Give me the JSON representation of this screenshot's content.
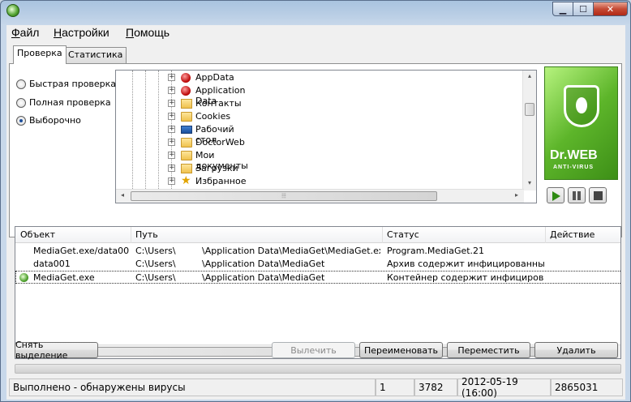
{
  "window": {
    "controls": {
      "minimize": "▁",
      "maximize": "☐",
      "close": "✕"
    }
  },
  "menu": {
    "file_ul": "Ф",
    "file_rest": "айл",
    "settings_ul": "Н",
    "settings_rest": "астройки",
    "help_ul": "П",
    "help_rest": "омощь"
  },
  "tabs": [
    {
      "label": "Проверка"
    },
    {
      "label": "Статистика"
    }
  ],
  "scan_modes": [
    {
      "label": "Быстрая проверка",
      "checked": false
    },
    {
      "label": "Полная проверка",
      "checked": false
    },
    {
      "label": "Выборочно",
      "checked": true
    }
  ],
  "tree": {
    "items": [
      {
        "label": "AppData",
        "icon": "red-dot-icon"
      },
      {
        "label": "Application Data",
        "icon": "red-dot-icon"
      },
      {
        "label": "Контакты",
        "icon": "contacts-folder-icon"
      },
      {
        "label": "Cookies",
        "icon": "folder-icon"
      },
      {
        "label": "Рабочий стол",
        "icon": "desktop-icon"
      },
      {
        "label": "DoctorWeb",
        "icon": "folder-icon"
      },
      {
        "label": "Мои документы",
        "icon": "folder-icon"
      },
      {
        "label": "Загрузки",
        "icon": "downloads-folder-icon"
      },
      {
        "label": "Избранное",
        "icon": "favorites-star-icon"
      }
    ]
  },
  "logo": {
    "title": "Dr.WEB",
    "subtitle": "ANTI-VIRUS"
  },
  "grid": {
    "columns": [
      "Объект",
      "Путь",
      "Статус",
      "Действие"
    ],
    "rows": [
      {
        "object": "MediaGet.exe/data00...",
        "path_a": "C:\\Users\\",
        "path_b": "\\Application Data\\MediaGet\\MediaGet.exe...",
        "status": "Program.MediaGet.21",
        "action": ""
      },
      {
        "object": "data001",
        "path_a": "C:\\Users\\",
        "path_b": "\\Application Data\\MediaGet",
        "status": "Архив содержит инфицированные...",
        "action": ""
      },
      {
        "object": "MediaGet.exe",
        "path_a": "C:\\Users\\",
        "path_b": "\\Application Data\\MediaGet",
        "status": "Контейнер содержит инфицирова...",
        "action": ""
      }
    ]
  },
  "buttons": {
    "deselect": "Снять выделение",
    "cure": "Вылечить",
    "rename": "Переименовать",
    "move": "Переместить",
    "delete": "Удалить"
  },
  "status": {
    "message": "Выполнено - обнаружены вирусы",
    "count": "1",
    "files": "3782",
    "datetime": "2012-05-19 (16:00)",
    "records": "2865031"
  },
  "scroll": {
    "left_arrow": "◂",
    "right_arrow": "▸",
    "up_arrow": "▴",
    "down_arrow": "▾",
    "grip": "⦙⦙⦙"
  },
  "tree_glyphs": {
    "expander": "+"
  }
}
